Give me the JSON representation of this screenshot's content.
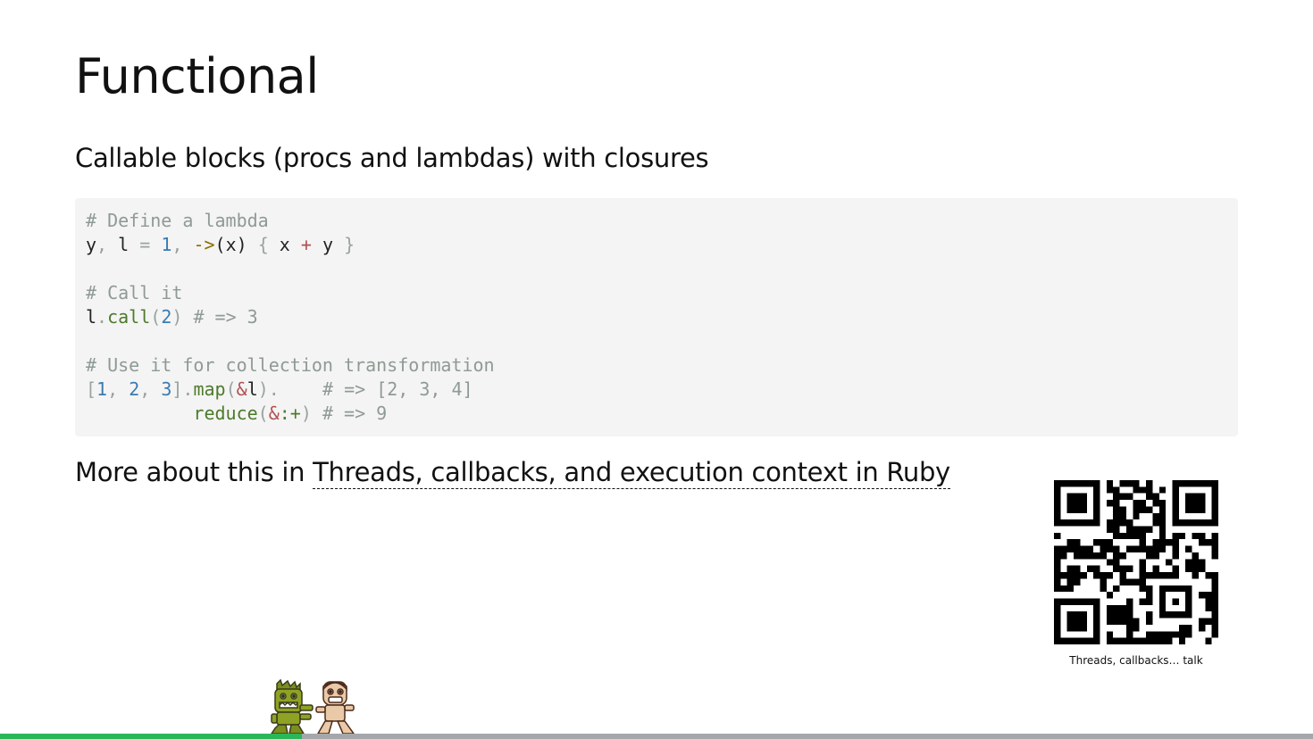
{
  "slide": {
    "title": "Functional",
    "subtitle": "Callable blocks (procs and lambdas) with closures",
    "code_lines": [
      "# Define a lambda",
      "y, l = 1, ->(x) { x + y }",
      "",
      "# Call it",
      "l.call(2) # => 3",
      "",
      "# Use it for collection transformation",
      "[1, 2, 3].map(&l).    # => [2, 3, 4]",
      "          reduce(&:+) # => 9"
    ],
    "more_prefix": "More about this in ",
    "more_link": "Threads, callbacks, and execution context in Ruby",
    "qr_caption": "Threads, callbacks… talk"
  },
  "progress": {
    "value": 0.23,
    "fill_color": "#2cb65a",
    "track_color": "#a5a8ab"
  },
  "icons": {
    "mascots": "monster-chasing-person-icon",
    "qr": "qr-code-icon"
  },
  "colors": {
    "background": "#ffffff",
    "code_background": "#f4f4f4",
    "text": "#111111"
  }
}
